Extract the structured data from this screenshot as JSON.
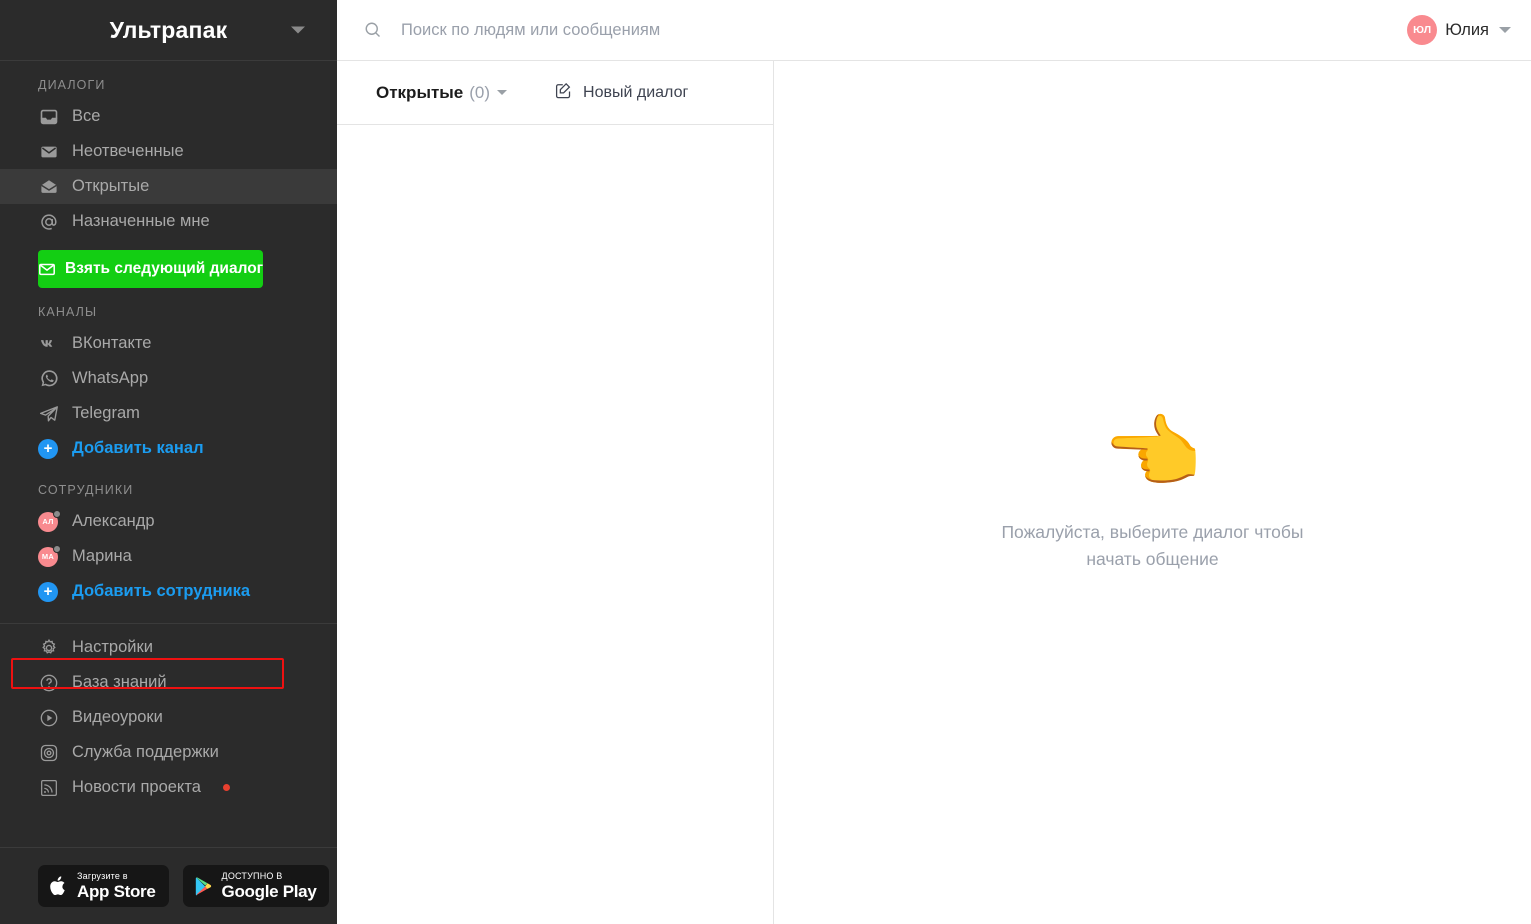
{
  "sidebar": {
    "brand": {
      "title": "Ультрапак",
      "caret_icon": "chevron-down-icon"
    },
    "dialogs": {
      "group_label": "ДИАЛОГИ",
      "items": [
        {
          "label": "Все",
          "icon": "inbox-tray-icon",
          "active": false
        },
        {
          "label": "Неотвеченные",
          "icon": "closed-envelope-icon",
          "active": false
        },
        {
          "label": "Открытые",
          "icon": "open-envelope-icon",
          "active": true
        },
        {
          "label": "Назначенные мне",
          "icon": "at-sign-icon",
          "active": false
        }
      ],
      "take_next_button": {
        "label": "Взять следующий диалог",
        "icon": "envelope-icon",
        "color": "#13ce13"
      }
    },
    "channels": {
      "group_label": "КАНАЛЫ",
      "items": [
        {
          "label": "ВКонтакте",
          "icon": "vk-icon"
        },
        {
          "label": "WhatsApp",
          "icon": "whatsapp-icon"
        },
        {
          "label": "Telegram",
          "icon": "telegram-icon"
        }
      ],
      "add_label": "Добавить канал",
      "add_icon": "plus-circle-icon"
    },
    "staff": {
      "group_label": "СОТРУДНИКИ",
      "items": [
        {
          "label": "Александр",
          "initials": "АЛ",
          "avatar_color": "#f98a8f",
          "status": "offline"
        },
        {
          "label": "Марина",
          "initials": "МА",
          "avatar_color": "#f98a8f",
          "status": "offline"
        }
      ],
      "add_label": "Добавить сотрудника",
      "add_icon": "plus-circle-icon"
    },
    "utility": {
      "items": [
        {
          "label": "Настройки",
          "icon": "gear-icon",
          "highlighted": true,
          "badge": false
        },
        {
          "label": "База знаний",
          "icon": "question-circle-icon",
          "highlighted": false,
          "badge": false
        },
        {
          "label": "Видеоуроки",
          "icon": "play-circle-icon",
          "highlighted": false,
          "badge": false
        },
        {
          "label": "Служба поддержки",
          "icon": "lifebuoy-icon",
          "highlighted": false,
          "badge": false
        },
        {
          "label": "Новости проекта",
          "icon": "rss-icon",
          "highlighted": false,
          "badge": true
        }
      ],
      "highlight_color": "#ee1111",
      "badge_color": "#e8402f"
    },
    "stores": [
      {
        "small": "Загрузите в",
        "big": "App Store",
        "icon": "apple-icon"
      },
      {
        "small": "ДОСТУПНО В",
        "big": "Google Play",
        "icon": "google-play-icon"
      }
    ]
  },
  "topbar": {
    "search": {
      "placeholder": "Поиск по людям или сообщениям",
      "value": "",
      "icon": "search-icon"
    },
    "user": {
      "name": "Юлия",
      "initials": "ЮЛ",
      "avatar_color": "#f98a8f",
      "caret_icon": "chevron-down-icon"
    }
  },
  "dialogs_panel": {
    "filter": {
      "name": "Открытые",
      "count": "(0)",
      "caret_icon": "chevron-down-icon"
    },
    "new_dialog": {
      "label": "Новый диалог",
      "icon": "compose-icon"
    }
  },
  "conversation": {
    "empty_emoji": "👈",
    "empty_emoji_name": "pointing-left-hand-emoji",
    "empty_text": "Пожалуйста, выберите диалог чтобы начать общение"
  }
}
